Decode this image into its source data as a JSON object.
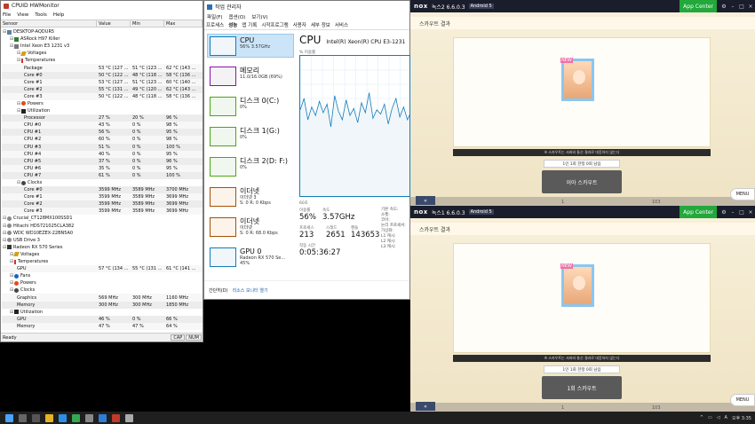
{
  "hwmonitor": {
    "title": "CPUID HWMonitor",
    "menu": [
      "File",
      "View",
      "Tools",
      "Help"
    ],
    "columns": [
      "Sensor",
      "Value",
      "Min",
      "Max"
    ],
    "rows": [
      {
        "depth": 0,
        "icon": "computer-icon",
        "name": "DESKTOP-AQDUR5",
        "value": "",
        "min": "",
        "max": "",
        "sensor": false
      },
      {
        "depth": 1,
        "icon": "motherboard-icon",
        "name": "ASRock H97 Killer",
        "value": "",
        "min": "",
        "max": "",
        "sensor": false
      },
      {
        "depth": 1,
        "icon": "cpu-icon",
        "name": "Intel Xeon E3 1231 v3",
        "value": "",
        "min": "",
        "max": "",
        "sensor": false
      },
      {
        "depth": 2,
        "icon": "voltage-icon",
        "name": "Voltages",
        "value": "",
        "min": "",
        "max": "",
        "sensor": false
      },
      {
        "depth": 2,
        "icon": "thermometer-icon",
        "name": "Temperatures",
        "value": "",
        "min": "",
        "max": "",
        "sensor": false
      },
      {
        "depth": 3,
        "icon": "",
        "name": "Package",
        "value": "53 °C  (127 ...",
        "min": "51 °C  (123 ...",
        "max": "62 °C  (143 ...",
        "sensor": true
      },
      {
        "depth": 3,
        "icon": "",
        "name": "Core #0",
        "value": "50 °C  (122 ...",
        "min": "48 °C  (118 ...",
        "max": "58 °C  (136 ...",
        "sensor": true
      },
      {
        "depth": 3,
        "icon": "",
        "name": "Core #1",
        "value": "53 °C  (127 ...",
        "min": "51 °C  (123 ...",
        "max": "60 °C  (140 ...",
        "sensor": true
      },
      {
        "depth": 3,
        "icon": "",
        "name": "Core #2",
        "value": "55 °C  (131 ...",
        "min": "49 °C  (120 ...",
        "max": "62 °C  (143 ...",
        "sensor": true
      },
      {
        "depth": 3,
        "icon": "",
        "name": "Core #3",
        "value": "50 °C  (122 ...",
        "min": "48 °C  (118 ...",
        "max": "58 °C  (136 ...",
        "sensor": true
      },
      {
        "depth": 2,
        "icon": "power-icon",
        "name": "Powers",
        "value": "",
        "min": "",
        "max": "",
        "sensor": false
      },
      {
        "depth": 2,
        "icon": "utilization-icon",
        "name": "Utilization",
        "value": "",
        "min": "",
        "max": "",
        "sensor": false
      },
      {
        "depth": 3,
        "icon": "",
        "name": "Processor",
        "value": "27 %",
        "min": "20 %",
        "max": "96 %",
        "sensor": true
      },
      {
        "depth": 3,
        "icon": "",
        "name": "CPU #0",
        "value": "43 %",
        "min": "0 %",
        "max": "98 %",
        "sensor": true
      },
      {
        "depth": 3,
        "icon": "",
        "name": "CPU #1",
        "value": "56 %",
        "min": "0 %",
        "max": "95 %",
        "sensor": true
      },
      {
        "depth": 3,
        "icon": "",
        "name": "CPU #2",
        "value": "60 %",
        "min": "0 %",
        "max": "98 %",
        "sensor": true
      },
      {
        "depth": 3,
        "icon": "",
        "name": "CPU #3",
        "value": "51 %",
        "min": "0 %",
        "max": "100 %",
        "sensor": true
      },
      {
        "depth": 3,
        "icon": "",
        "name": "CPU #4",
        "value": "40 %",
        "min": "0 %",
        "max": "95 %",
        "sensor": true
      },
      {
        "depth": 3,
        "icon": "",
        "name": "CPU #5",
        "value": "37 %",
        "min": "0 %",
        "max": "96 %",
        "sensor": true
      },
      {
        "depth": 3,
        "icon": "",
        "name": "CPU #6",
        "value": "35 %",
        "min": "0 %",
        "max": "95 %",
        "sensor": true
      },
      {
        "depth": 3,
        "icon": "",
        "name": "CPU #7",
        "value": "61 %",
        "min": "0 %",
        "max": "100 %",
        "sensor": true
      },
      {
        "depth": 2,
        "icon": "clock-icon",
        "name": "Clocks",
        "value": "",
        "min": "",
        "max": "",
        "sensor": false
      },
      {
        "depth": 3,
        "icon": "",
        "name": "Core #0",
        "value": "3599 MHz",
        "min": "3589 MHz",
        "max": "3700 MHz",
        "sensor": true
      },
      {
        "depth": 3,
        "icon": "",
        "name": "Core #1",
        "value": "3599 MHz",
        "min": "3589 MHz",
        "max": "3699 MHz",
        "sensor": true
      },
      {
        "depth": 3,
        "icon": "",
        "name": "Core #2",
        "value": "3599 MHz",
        "min": "3589 MHz",
        "max": "3699 MHz",
        "sensor": true
      },
      {
        "depth": 3,
        "icon": "",
        "name": "Core #3",
        "value": "3599 MHz",
        "min": "3589 MHz",
        "max": "3699 MHz",
        "sensor": true
      },
      {
        "depth": 0,
        "icon": "disk-icon",
        "name": "Crucial_CT128MX100SSD1",
        "value": "",
        "min": "",
        "max": "",
        "sensor": false
      },
      {
        "depth": 0,
        "icon": "disk-icon",
        "name": "Hitachi HDS721025CLA382",
        "value": "",
        "min": "",
        "max": "",
        "sensor": false
      },
      {
        "depth": 0,
        "icon": "disk-icon",
        "name": "WDC WD10EZEX-22BN5A0",
        "value": "",
        "min": "",
        "max": "",
        "sensor": false
      },
      {
        "depth": 0,
        "icon": "disk-icon",
        "name": "USB Drive 3",
        "value": "",
        "min": "",
        "max": "",
        "sensor": false
      },
      {
        "depth": 0,
        "icon": "gpu-icon",
        "name": "Radeon RX 570 Series",
        "value": "",
        "min": "",
        "max": "",
        "sensor": false
      },
      {
        "depth": 1,
        "icon": "voltage-icon",
        "name": "Voltages",
        "value": "",
        "min": "",
        "max": "",
        "sensor": false
      },
      {
        "depth": 1,
        "icon": "thermometer-icon",
        "name": "Temperatures",
        "value": "",
        "min": "",
        "max": "",
        "sensor": false
      },
      {
        "depth": 2,
        "icon": "",
        "name": "GPU",
        "value": "57 °C  (134 ...",
        "min": "55 °C  (131 ...",
        "max": "61 °C  (141 ...",
        "sensor": true
      },
      {
        "depth": 1,
        "icon": "fan-icon",
        "name": "Fans",
        "value": "",
        "min": "",
        "max": "",
        "sensor": false
      },
      {
        "depth": 1,
        "icon": "power-icon",
        "name": "Powers",
        "value": "",
        "min": "",
        "max": "",
        "sensor": false
      },
      {
        "depth": 1,
        "icon": "clock-icon",
        "name": "Clocks",
        "value": "",
        "min": "",
        "max": "",
        "sensor": false
      },
      {
        "depth": 2,
        "icon": "",
        "name": "Graphics",
        "value": "569 MHz",
        "min": "300 MHz",
        "max": "1160 MHz",
        "sensor": true
      },
      {
        "depth": 2,
        "icon": "",
        "name": "Memory",
        "value": "300 MHz",
        "min": "300 MHz",
        "max": "1850 MHz",
        "sensor": true
      },
      {
        "depth": 1,
        "icon": "utilization-icon",
        "name": "Utilization",
        "value": "",
        "min": "",
        "max": "",
        "sensor": false
      },
      {
        "depth": 2,
        "icon": "",
        "name": "GPU",
        "value": "46 %",
        "min": "0 %",
        "max": "66 %",
        "sensor": true
      },
      {
        "depth": 2,
        "icon": "",
        "name": "Memory",
        "value": "47 %",
        "min": "47 %",
        "max": "64 %",
        "sensor": true
      }
    ],
    "status": "Ready",
    "indicators": [
      "CAP",
      "NUM"
    ]
  },
  "taskmanager": {
    "title": "작업 관리자",
    "menu": [
      "파일(F)",
      "옵션(O)",
      "보기(V)"
    ],
    "tabs": [
      "프로세스",
      "성능",
      "앱 기록",
      "시작프로그램",
      "사용자",
      "세부 정보",
      "서비스"
    ],
    "active_tab": "성능",
    "tiles": [
      {
        "title": "CPU",
        "sub1": "56% 3.57GHz",
        "sub2": "",
        "color": "#117dbb",
        "bg": "#f1f6fa"
      },
      {
        "title": "메모리",
        "sub1": "11.0/16.0GB (69%)",
        "sub2": "",
        "color": "#8b12ae",
        "bg": "#f4f2f4"
      },
      {
        "title": "디스크 0(C:)",
        "sub1": "0%",
        "sub2": "",
        "color": "#4da60c",
        "bg": "#eff7ef"
      },
      {
        "title": "디스크 1(G:)",
        "sub1": "0%",
        "sub2": "",
        "color": "#4da60c",
        "bg": "#eff7ef"
      },
      {
        "title": "디스크 2(D: F:)",
        "sub1": "0%",
        "sub2": "",
        "color": "#4da60c",
        "bg": "#eff7ef"
      },
      {
        "title": "이더넷",
        "sub1": "이더넷 3",
        "sub2": "S: 0  R: 0 Kbps",
        "color": "#a74f01",
        "bg": "#fcf3eb"
      },
      {
        "title": "이더넷",
        "sub1": "이더넷",
        "sub2": "S: 0  R: 68.0 Kbps",
        "color": "#a74f01",
        "bg": "#fcf3eb"
      },
      {
        "title": "GPU 0",
        "sub1": "Radeon RX 570 Se...",
        "sub2": "45%",
        "color": "#117dbb",
        "bg": "#f1f6fa"
      }
    ],
    "cpu": {
      "heading": "CPU",
      "model": "Intel(R) Xeon(R) CPU E3-1231",
      "graph_label": "% 이용률",
      "graph_left_label": "60초",
      "stats": [
        {
          "label": "이용률",
          "value": "56%"
        },
        {
          "label": "속도",
          "value": "3.57GHz"
        },
        {
          "label": "프로세스",
          "value": "213"
        },
        {
          "label": "스레드",
          "value": "2651"
        },
        {
          "label": "핸들",
          "value": "143653"
        },
        {
          "label": "작동 시간",
          "value": "0:05:36:27"
        }
      ],
      "specs": [
        "기본 속도:",
        "소켓:",
        "코어:",
        "논리 프로세서:",
        "가상화:",
        "L1 캐시:",
        "L2 캐시:",
        "L3 캐시:"
      ],
      "graph_values": [
        0.62,
        0.7,
        0.55,
        0.64,
        0.58,
        0.68,
        0.6,
        0.66,
        0.5,
        0.72,
        0.61,
        0.55,
        0.69,
        0.58,
        0.63,
        0.53,
        0.67,
        0.6,
        0.74,
        0.56,
        0.62,
        0.59,
        0.66,
        0.52,
        0.63,
        0.7,
        0.57,
        0.64,
        0.55,
        0.61
      ]
    },
    "footer_less": "간단히(D)",
    "footer_link": "리소스 모니터 열기"
  },
  "nox_windows": [
    {
      "logo": "nox",
      "version": "녹스2 6.6.0.3",
      "android": "Android 5",
      "app_center": "App Center",
      "game_title": "스카우트 결과",
      "card_badge": "NEW",
      "notice": "※ 스카우트는 서버와 통신 결과로 대응하지 않는다",
      "limit": "1인 1회 한정 0회 남음",
      "scout_button": "이아 스카우트",
      "back": "«",
      "coins_left": "1",
      "coins_right": "103",
      "menu": "MENU"
    },
    {
      "logo": "nox",
      "version": "녹스1 6.6.0.3",
      "android": "Android 5",
      "app_center": "App Center",
      "game_title": "스카우트 결과",
      "card_badge": "NEW",
      "notice": "※ 스카우트는 서버와 통신 결과로 대응하지 않는다",
      "limit": "1인 1회 한정 0회 남음",
      "scout_button": "1회 스카우트",
      "back": "«",
      "coins_left": "1",
      "coins_right": "103",
      "menu": "MENU"
    }
  ],
  "taskbar": {
    "tray_text": "^",
    "ime": "A",
    "time": "오후 3:35"
  }
}
